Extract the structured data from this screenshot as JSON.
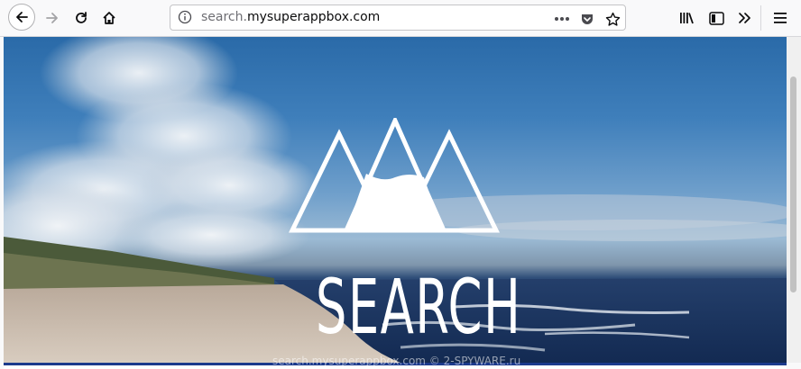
{
  "browser": {
    "url_prefix": "search.",
    "url_domain": "mysuperappbox.com",
    "icons": {
      "back": "back-arrow-icon",
      "forward": "forward-arrow-icon",
      "reload": "reload-icon",
      "home": "home-icon",
      "info": "info-icon",
      "page_actions": "more-horizontal-icon",
      "pocket": "pocket-icon",
      "bookmark": "star-icon",
      "library": "library-icon",
      "sidebar": "sidebar-icon",
      "overflow": "double-chevron-icon",
      "menu": "hamburger-icon"
    }
  },
  "page": {
    "logo_text": "SEARCH",
    "watermark": "search.mysuperappbox.com © 2-SPYWARE.ru"
  },
  "colors": {
    "toolbar_bg": "#f9f9fa",
    "bottom_border": "#1c3a8c"
  }
}
